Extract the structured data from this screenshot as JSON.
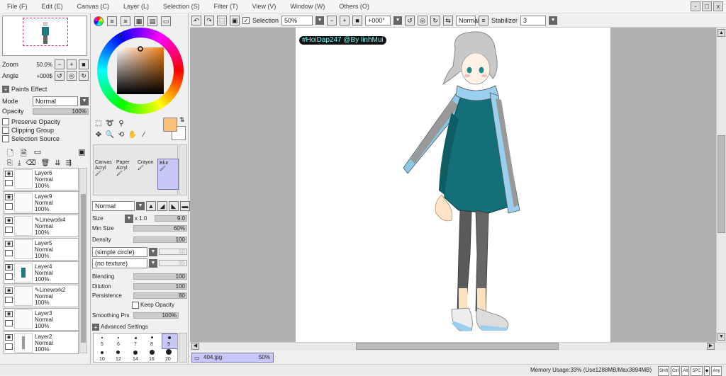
{
  "menu": [
    "File (F)",
    "Edit (E)",
    "Canvas (C)",
    "Layer (L)",
    "Selection (S)",
    "Filter (T)",
    "View (V)",
    "Window (W)",
    "Others (O)"
  ],
  "window_controls": {
    "minimize": "-",
    "maximize": "□",
    "close": "x"
  },
  "toolbar": {
    "selection_label": "Selection",
    "zoom_value": "50%",
    "angle_value": "+000°",
    "blend_mode": "Normal",
    "stabilizer_label": "Stabilizer",
    "stabilizer_value": "3"
  },
  "navigator": {
    "zoom_label": "Zoom",
    "zoom_value": "50.0%",
    "angle_label": "Angle",
    "angle_value": "+000$"
  },
  "layer_props": {
    "paints_effect": "Paints Effect",
    "mode_label": "Mode",
    "mode_value": "Normal",
    "opacity_label": "Opacity",
    "opacity_value": "100%",
    "preserve_opacity": "Preserve Opacity",
    "clipping_group": "Clipping Group",
    "selection_source": "Selection Source"
  },
  "layers": [
    {
      "name": "Layer6",
      "mode": "Normal",
      "opacity": "100%"
    },
    {
      "name": "Layer9",
      "mode": "Normal",
      "opacity": "100%"
    },
    {
      "name": "Linework4",
      "mode": "Normal",
      "opacity": "100%"
    },
    {
      "name": "Layer5",
      "mode": "Normal",
      "opacity": "100%"
    },
    {
      "name": "Layer4",
      "mode": "Normal",
      "opacity": "100%"
    },
    {
      "name": "Linework2",
      "mode": "Normal",
      "opacity": "100%"
    },
    {
      "name": "Layer3",
      "mode": "Normal",
      "opacity": "100%"
    },
    {
      "name": "Layer2",
      "mode": "Normal",
      "opacity": "100%"
    }
  ],
  "brush_tools": [
    {
      "line1": "Canvas",
      "line2": "Acryl"
    },
    {
      "line1": "Paper",
      "line2": "Acryl"
    },
    {
      "line1": "Crayon",
      "line2": ""
    },
    {
      "line1": "Blur",
      "line2": ""
    }
  ],
  "brush_settings": {
    "mode": "Normal",
    "size_label": "Size",
    "size_mult": "x 1.0",
    "size_value": "9.0",
    "min_size_label": "Min Size",
    "min_size_value": "60%",
    "density_label": "Density",
    "density_value": "100",
    "shape": "(simple circle)",
    "shape_value": "50",
    "texture": "(no texture)",
    "texture_value": "95",
    "blending_label": "Blending",
    "blending_value": "100",
    "dilution_label": "Dilution",
    "dilution_value": "100",
    "persistence_label": "Persistence",
    "persistence_value": "80",
    "keep_opacity": "Keep Opacity",
    "smoothing_label": "Smoothing Prs",
    "smoothing_value": "100%",
    "advanced": "Advanced Settings"
  },
  "brush_sizes": [
    "5",
    "6",
    "7",
    "8",
    "9",
    "10",
    "12",
    "14",
    "16",
    "20"
  ],
  "colors": {
    "foreground": "#f8c07a",
    "background": "#ffffff"
  },
  "watermark": "#HoiDap247 @By linhMui",
  "document_tab": {
    "name": "404.jpg",
    "zoom": "50%"
  },
  "status": {
    "memory": "Memory Usage:33% (Use1288MB/Max3894MB)",
    "keys": [
      "Shift",
      "Ctrl",
      "Alt",
      "SPC",
      "◆",
      "Any"
    ]
  }
}
